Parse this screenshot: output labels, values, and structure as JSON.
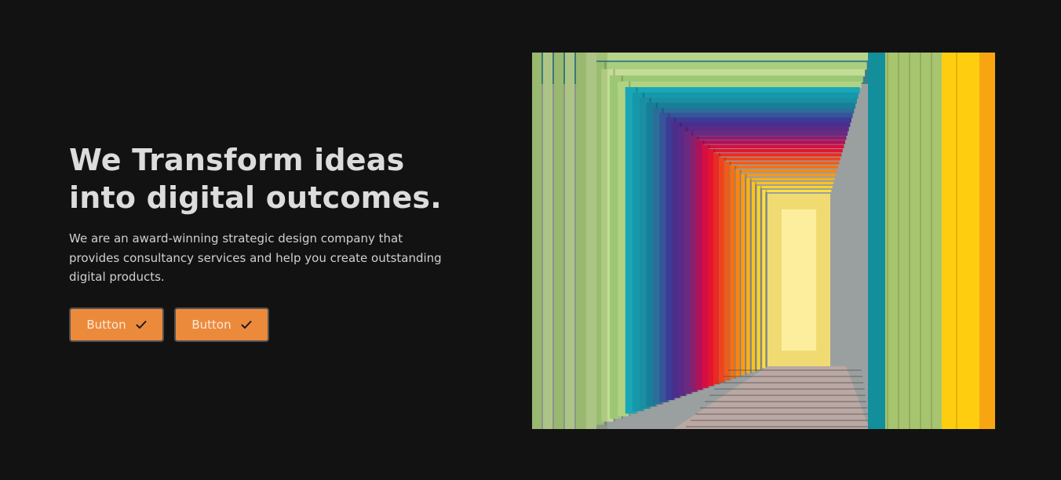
{
  "hero": {
    "title": "We Transform ideas into digital outcomes.",
    "description": "We are an award-winning strategic design company that provides consultancy services and help you create outstanding digital products.",
    "buttons": [
      {
        "label": "Button",
        "icon": "check-icon"
      },
      {
        "label": "Button",
        "icon": "check-icon"
      }
    ]
  },
  "image": {
    "subject": "rainbow-colored corridor of nested wooden frames"
  },
  "colors": {
    "background": "#121212",
    "button": "#ec8a3c",
    "button_border": "#505050",
    "heading": "#dcdcdc"
  }
}
